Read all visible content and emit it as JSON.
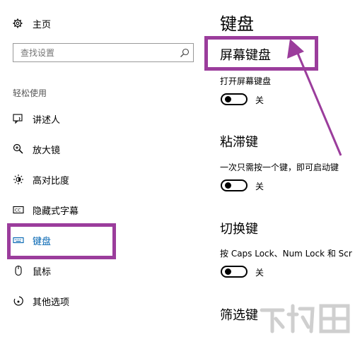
{
  "sidebar": {
    "home_label": "主页",
    "search_placeholder": "查找设置",
    "section_label": "轻松使用",
    "items": [
      {
        "label": "讲述人",
        "icon": "narrator-icon"
      },
      {
        "label": "放大镜",
        "icon": "magnifier-icon"
      },
      {
        "label": "高对比度",
        "icon": "high-contrast-icon"
      },
      {
        "label": "隐藏式字幕",
        "icon": "closed-captions-icon"
      },
      {
        "label": "键盘",
        "icon": "keyboard-icon",
        "selected": true
      },
      {
        "label": "鼠标",
        "icon": "mouse-icon"
      },
      {
        "label": "其他选项",
        "icon": "other-options-icon"
      }
    ]
  },
  "main": {
    "title": "键盘",
    "sections": [
      {
        "title": "屏幕键盘",
        "setting": "打开屏幕键盘",
        "state": "关"
      },
      {
        "title": "粘滞键",
        "setting": "一次只需按一个键，即可启动键",
        "state": "关"
      },
      {
        "title": "切换键",
        "setting": "按 Caps Lock、Num Lock 和 Scr",
        "state": "关"
      },
      {
        "title": "筛选键"
      }
    ]
  },
  "colors": {
    "accent": "#0063b1",
    "highlight": "#9b3d9c"
  },
  "watermark": {
    "text": "下载吧",
    "icon": "watermark-logo"
  }
}
